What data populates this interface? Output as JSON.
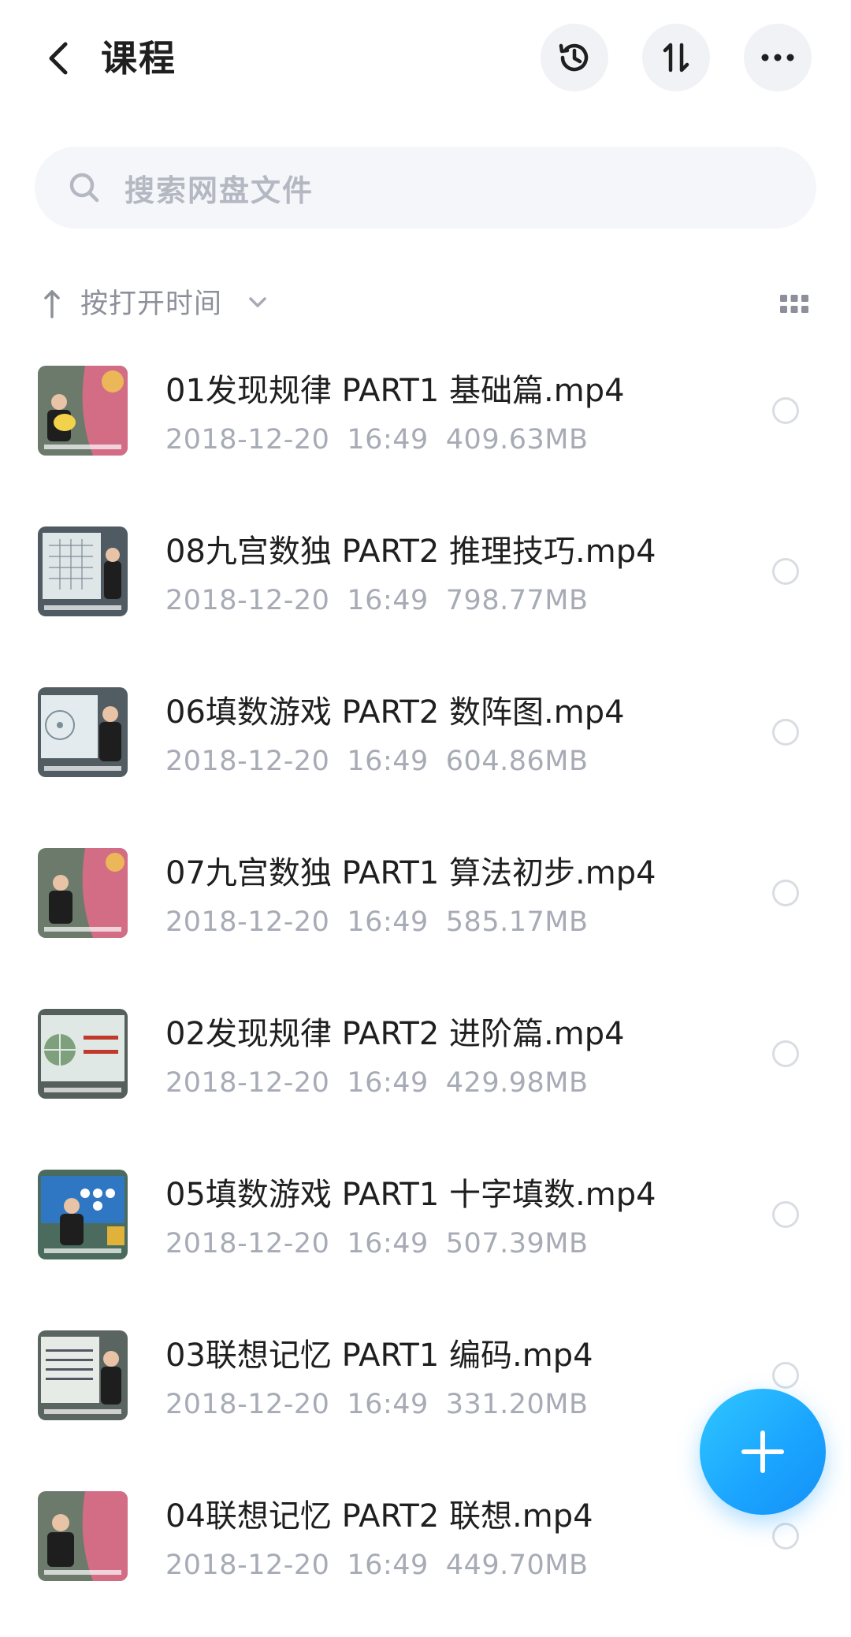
{
  "header": {
    "title": "课程",
    "back_icon": "chevron-left-icon",
    "actions": [
      "history-icon",
      "sort-icon",
      "more-icon"
    ]
  },
  "search": {
    "placeholder": "搜索网盘文件",
    "icon": "search-icon"
  },
  "sortbar": {
    "label": "按打开时间",
    "direction_icon": "arrow-up-icon",
    "dropdown_icon": "chevron-down-icon",
    "view_icon": "grid-view-icon"
  },
  "files": [
    {
      "name": "01发现规律 PART1 基础篇.mp4",
      "date": "2018-12-20",
      "time": "16:49",
      "size": "409.63MB"
    },
    {
      "name": "08九宫数独 PART2 推理技巧.mp4",
      "date": "2018-12-20",
      "time": "16:49",
      "size": "798.77MB"
    },
    {
      "name": "06填数游戏 PART2 数阵图.mp4",
      "date": "2018-12-20",
      "time": "16:49",
      "size": "604.86MB"
    },
    {
      "name": "07九宫数独 PART1 算法初步.mp4",
      "date": "2018-12-20",
      "time": "16:49",
      "size": "585.17MB"
    },
    {
      "name": "02发现规律 PART2 进阶篇.mp4",
      "date": "2018-12-20",
      "time": "16:49",
      "size": "429.98MB"
    },
    {
      "name": "05填数游戏 PART1 十字填数.mp4",
      "date": "2018-12-20",
      "time": "16:49",
      "size": "507.39MB"
    },
    {
      "name": "03联想记忆 PART1 编码.mp4",
      "date": "2018-12-20",
      "time": "16:49",
      "size": "331.20MB"
    },
    {
      "name": "04联想记忆 PART2 联想.mp4",
      "date": "2018-12-20",
      "time": "16:49",
      "size": "449.70MB"
    }
  ],
  "fab": {
    "icon": "plus-icon"
  },
  "colors": {
    "accent": "#1aa3ff",
    "muted": "#a7abb5"
  }
}
